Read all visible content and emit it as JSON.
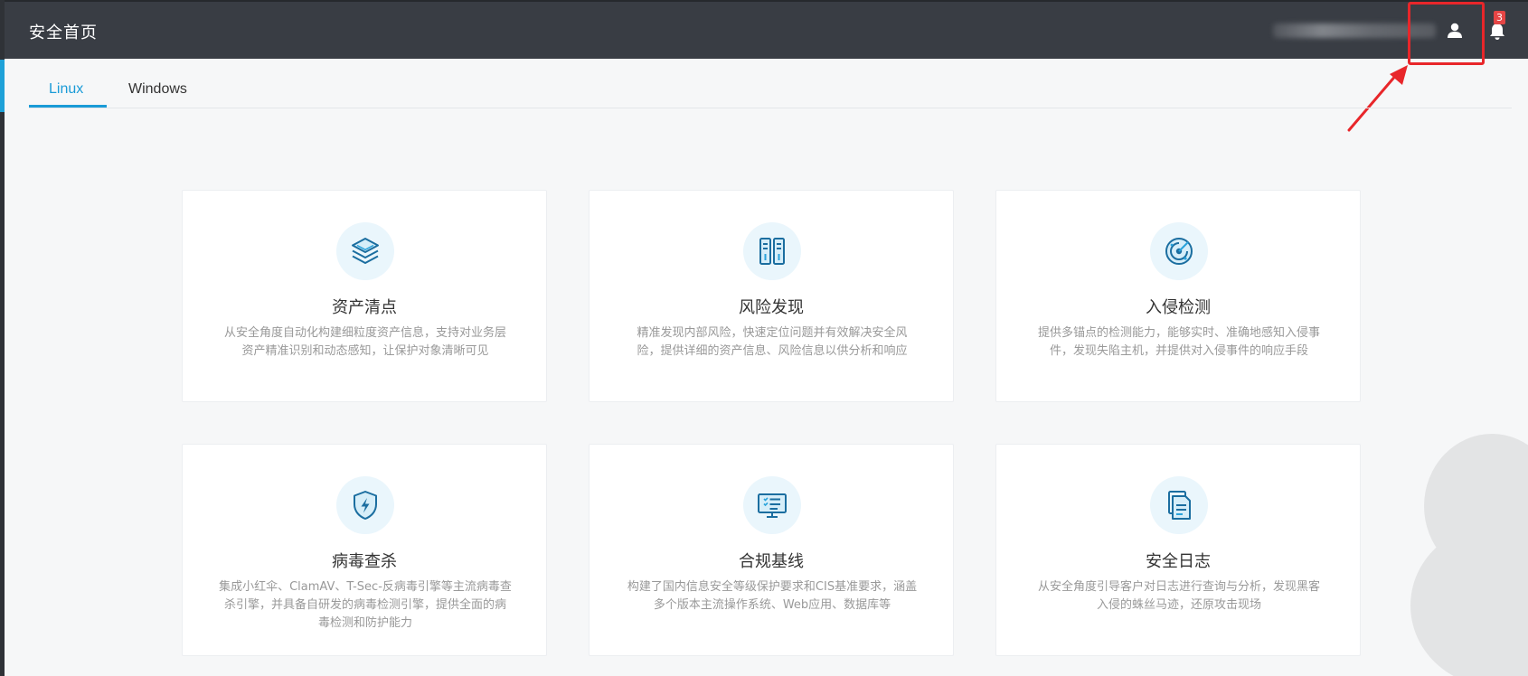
{
  "header": {
    "title": "安全首页",
    "notification_count": "3"
  },
  "tabs": [
    {
      "label": "Linux",
      "active": true
    },
    {
      "label": "Windows",
      "active": false
    }
  ],
  "cards": [
    {
      "title": "资产清点",
      "desc": "从安全角度自动化构建细粒度资产信息，支持对业务层资产精准识别和动态感知，让保护对象清晰可见",
      "icon": "layers-icon"
    },
    {
      "title": "风险发现",
      "desc": "精准发现内部风险，快速定位问题并有效解决安全风险，提供详细的资产信息、风险信息以供分析和响应",
      "icon": "server-icon"
    },
    {
      "title": "入侵检测",
      "desc": "提供多锚点的检测能力，能够实时、准确地感知入侵事件，发现失陷主机，并提供对入侵事件的响应手段",
      "icon": "radar-icon"
    },
    {
      "title": "病毒查杀",
      "desc": "集成小红伞、ClamAV、T-Sec-反病毒引擎等主流病毒查杀引擎，并具备自研发的病毒检测引擎，提供全面的病毒检测和防护能力",
      "icon": "shield-bolt-icon"
    },
    {
      "title": "合规基线",
      "desc": "构建了国内信息安全等级保护要求和CIS基准要求，涵盖多个版本主流操作系统、Web应用、数据库等",
      "icon": "monitor-checklist-icon"
    },
    {
      "title": "安全日志",
      "desc": "从安全角度引导客户对日志进行查询与分析，发现黑客入侵的蛛丝马迹，还原攻击现场",
      "icon": "document-icon"
    }
  ],
  "colors": {
    "header_bg": "#393d44",
    "accent": "#1a9bd7",
    "icon_bg": "#eaf6fc",
    "badge": "#e54545",
    "annotation": "#e8262a"
  }
}
